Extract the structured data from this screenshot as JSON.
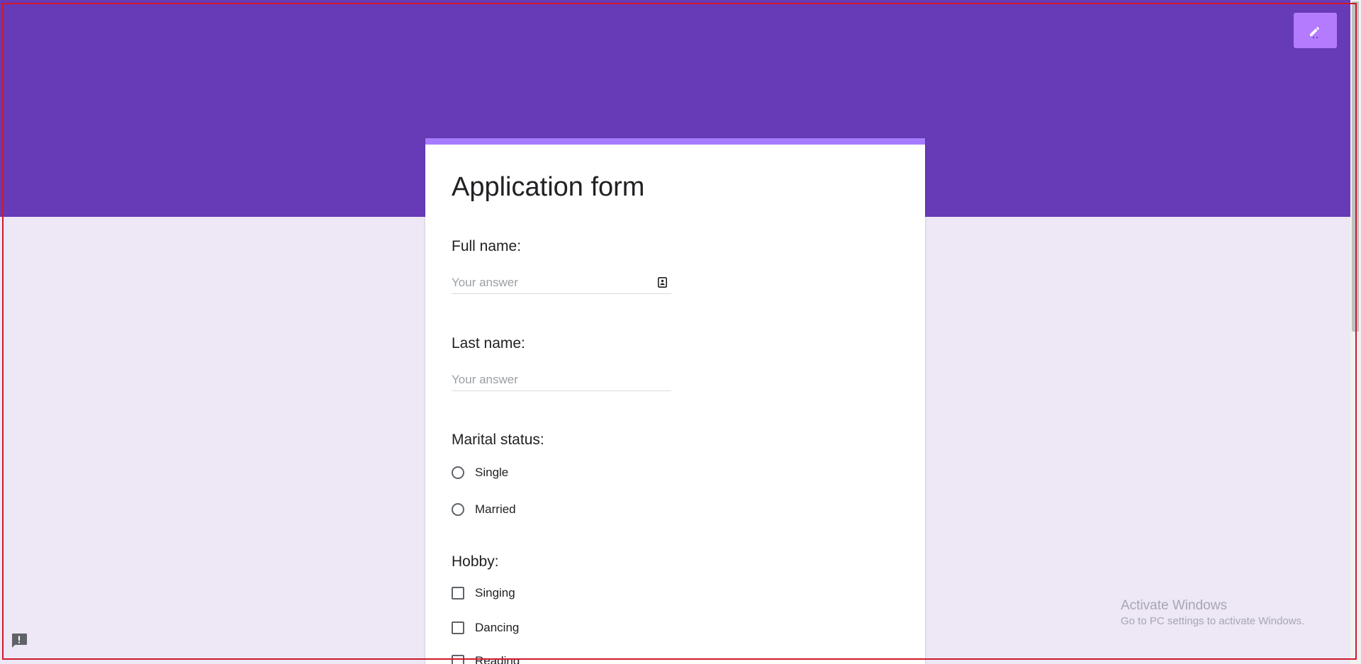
{
  "form": {
    "title": "Application form",
    "questions": [
      {
        "label": "Full name:",
        "placeholder": "Your answer"
      },
      {
        "label": "Last name:",
        "placeholder": "Your answer"
      }
    ],
    "marital_status": {
      "label": "Marital status:",
      "options": [
        "Single",
        "Married"
      ]
    },
    "hobby": {
      "label": "Hobby:",
      "options": [
        "Singing",
        "Dancing",
        "Reading"
      ]
    }
  },
  "watermark": {
    "title": "Activate Windows",
    "subtitle": "Go to PC settings to activate Windows."
  },
  "icons": {
    "edit": "pencil-icon",
    "contact": "contact-card-icon",
    "feedback": "feedback-icon"
  },
  "colors": {
    "header": "#673ab7",
    "background": "#ede7f6",
    "card_accent": "#a77bff",
    "edit_button": "#b57bff"
  }
}
